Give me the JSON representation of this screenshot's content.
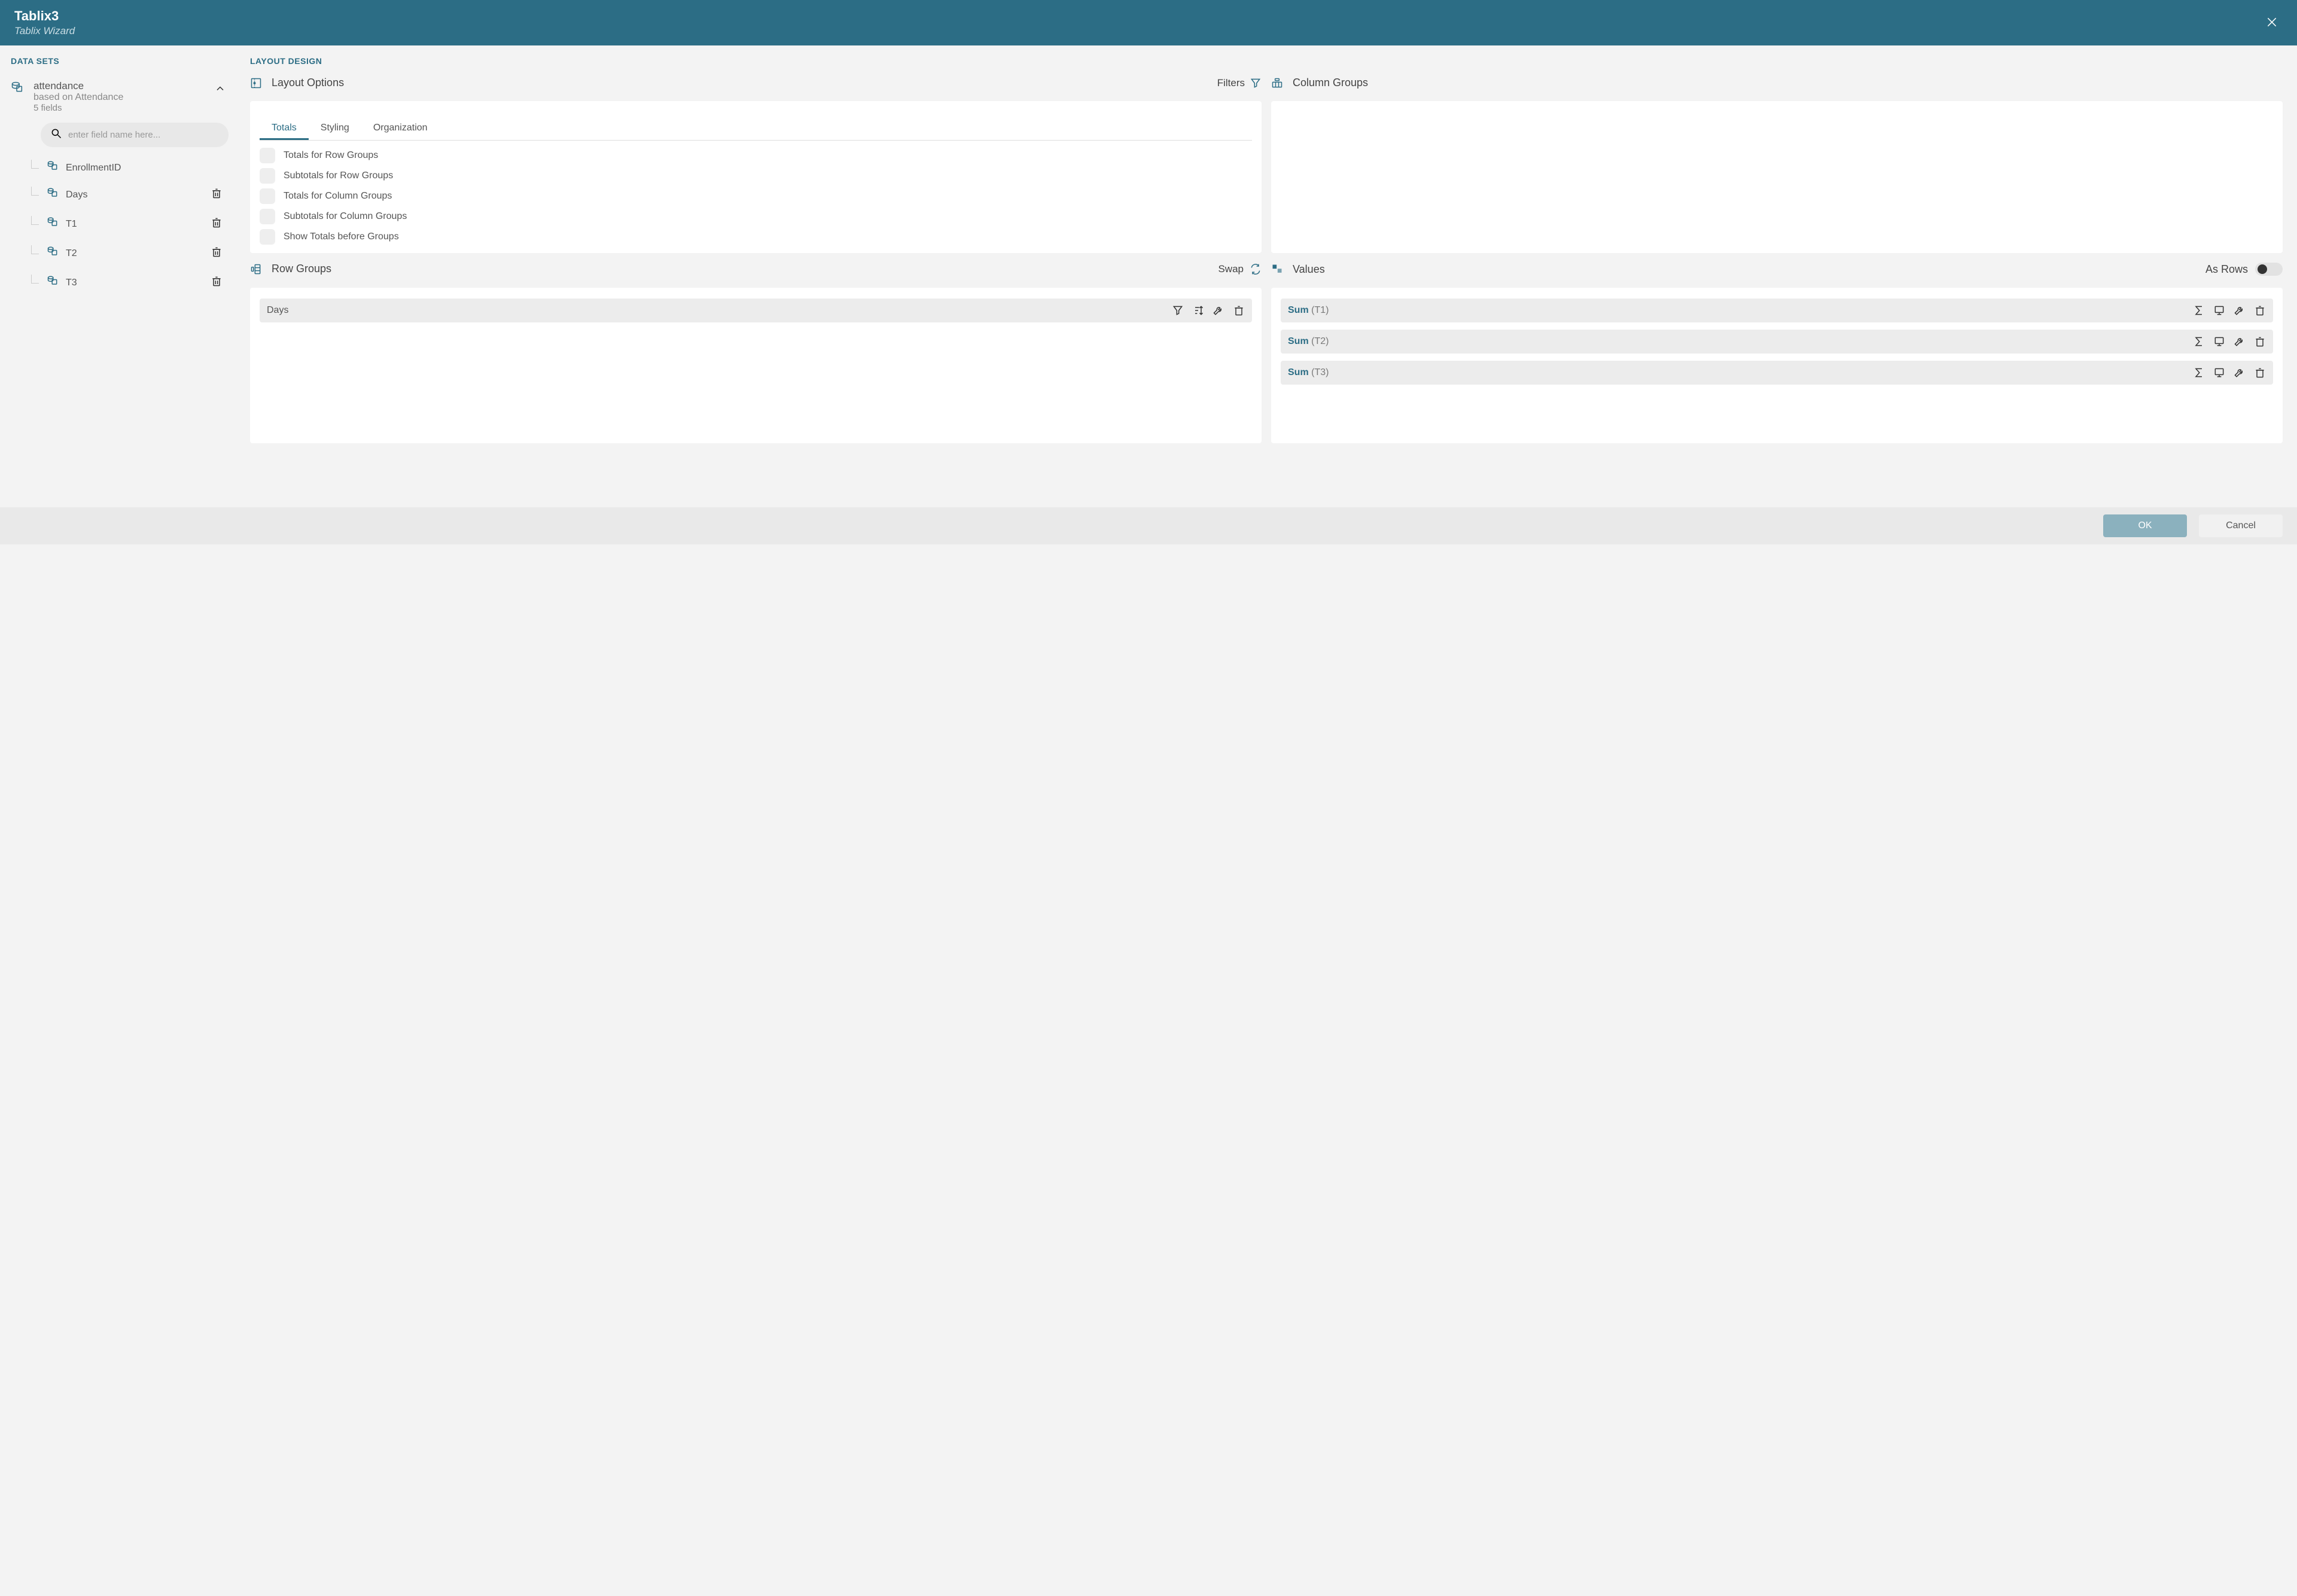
{
  "header": {
    "title": "Tablix3",
    "subtitle": "Tablix Wizard"
  },
  "sidebar": {
    "title": "DATA SETS",
    "dataset": {
      "name": "attendance",
      "based_on": "based on Attendance",
      "field_count": "5 fields"
    },
    "search_placeholder": "enter field name here...",
    "fields": [
      {
        "label": "EnrollmentID",
        "deletable": false
      },
      {
        "label": "Days",
        "deletable": true
      },
      {
        "label": "T1",
        "deletable": true
      },
      {
        "label": "T2",
        "deletable": true
      },
      {
        "label": "T3",
        "deletable": true
      }
    ]
  },
  "layout": {
    "title": "LAYOUT DESIGN",
    "layout_options": {
      "heading": "Layout Options",
      "filters_label": "Filters",
      "tabs": [
        "Totals",
        "Styling",
        "Organization"
      ],
      "active_tab": 0,
      "checks": [
        "Totals for Row Groups",
        "Subtotals for Row Groups",
        "Totals for Column Groups",
        "Subtotals for Column Groups",
        "Show Totals before Groups"
      ]
    },
    "column_groups": {
      "heading": "Column Groups"
    },
    "row_groups": {
      "heading": "Row Groups",
      "swap_label": "Swap",
      "items": [
        {
          "label": "Days"
        }
      ]
    },
    "values": {
      "heading": "Values",
      "as_rows_label": "As Rows",
      "items": [
        {
          "agg": "Sum",
          "field": "(T1)"
        },
        {
          "agg": "Sum",
          "field": "(T2)"
        },
        {
          "agg": "Sum",
          "field": "(T3)"
        }
      ]
    }
  },
  "footer": {
    "ok": "OK",
    "cancel": "Cancel"
  }
}
